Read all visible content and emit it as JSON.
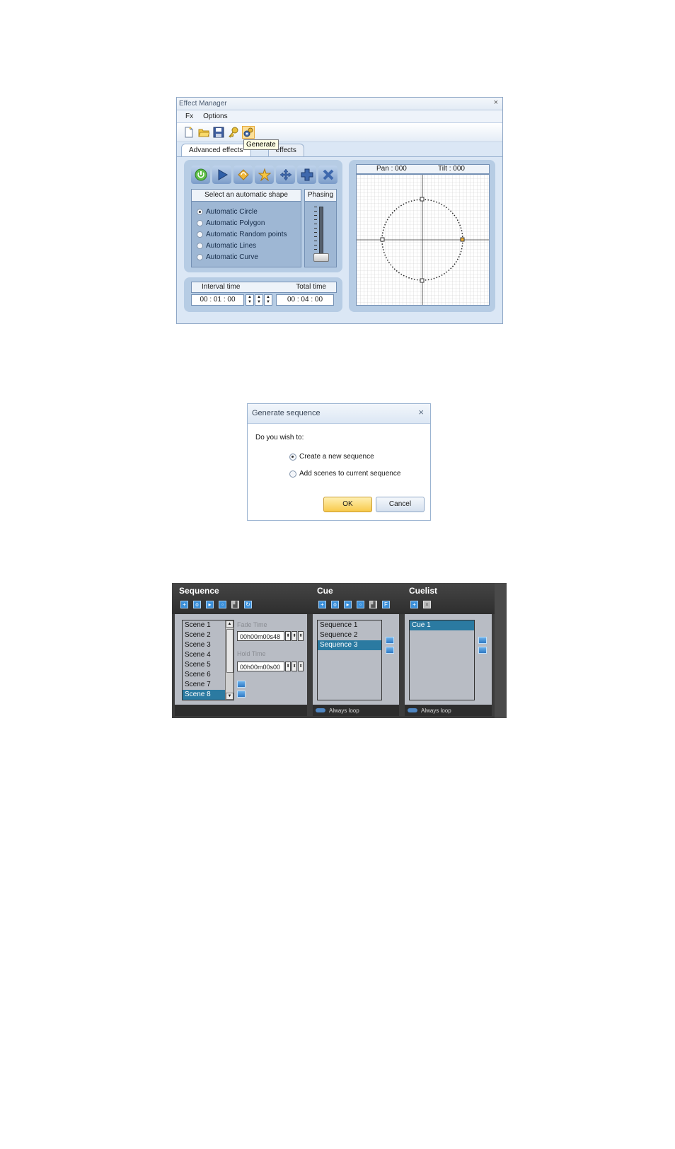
{
  "effect_manager": {
    "title": "Effect Manager",
    "close_glyph": "×",
    "menu": [
      "Fx",
      "Options"
    ],
    "toolbar": {
      "icons": [
        "new-file-icon",
        "open-folder-icon",
        "save-icon",
        "key-icon",
        "generate-icon"
      ],
      "tooltip": "Generate"
    },
    "tabs": {
      "advanced": "Advanced effects",
      "other": "effects"
    },
    "fx_buttons": [
      "power-icon",
      "play-icon",
      "rotate-icon",
      "star-icon",
      "move-icon",
      "cross-icon",
      "delete-icon"
    ],
    "shape_header": "Select an automatic shape",
    "shapes": [
      {
        "label": "Automatic Circle",
        "selected": true
      },
      {
        "label": "Automatic Polygon",
        "selected": false
      },
      {
        "label": "Automatic Random points",
        "selected": false
      },
      {
        "label": "Automatic Lines",
        "selected": false
      },
      {
        "label": "Automatic Curve",
        "selected": false
      }
    ],
    "phasing_header": "Phasing",
    "interval_label": "Interval time",
    "total_label": "Total time",
    "interval_value": "00 : 01 : 00",
    "total_value": "00 : 04 : 00",
    "pan_label": "Pan  :  000",
    "tilt_label": "Tilt  :  000"
  },
  "dialog": {
    "title": "Generate sequence",
    "close_glyph": "×",
    "question": "Do you wish to:",
    "options": [
      {
        "label": "Create a new sequence",
        "selected": true
      },
      {
        "label": "Add scenes to current sequence",
        "selected": false
      }
    ],
    "ok_label": "OK",
    "cancel_label": "Cancel"
  },
  "sequence_panel": {
    "sequence": {
      "title": "Sequence",
      "scenes": [
        "Scene 1",
        "Scene 2",
        "Scene 3",
        "Scene 4",
        "Scene 5",
        "Scene 6",
        "Scene 7",
        "Scene 8"
      ],
      "selected_index": 7,
      "fade_label": "Fade Time",
      "fade_value": "00h00m00s48",
      "hold_label": "Hold Time",
      "hold_value": "00h00m00s00"
    },
    "cue": {
      "title": "Cue",
      "items": [
        "Sequence 1",
        "Sequence 2",
        "Sequence 3"
      ],
      "selected_index": 2,
      "loop_label": "Always loop"
    },
    "cuelist": {
      "title": "Cuelist",
      "items": [
        "Cue 1"
      ],
      "selected_index": 0,
      "loop_label": "Always loop"
    },
    "colors": {
      "selection": "#2b7aa1",
      "icon_blue": "#3b8fd9"
    }
  }
}
